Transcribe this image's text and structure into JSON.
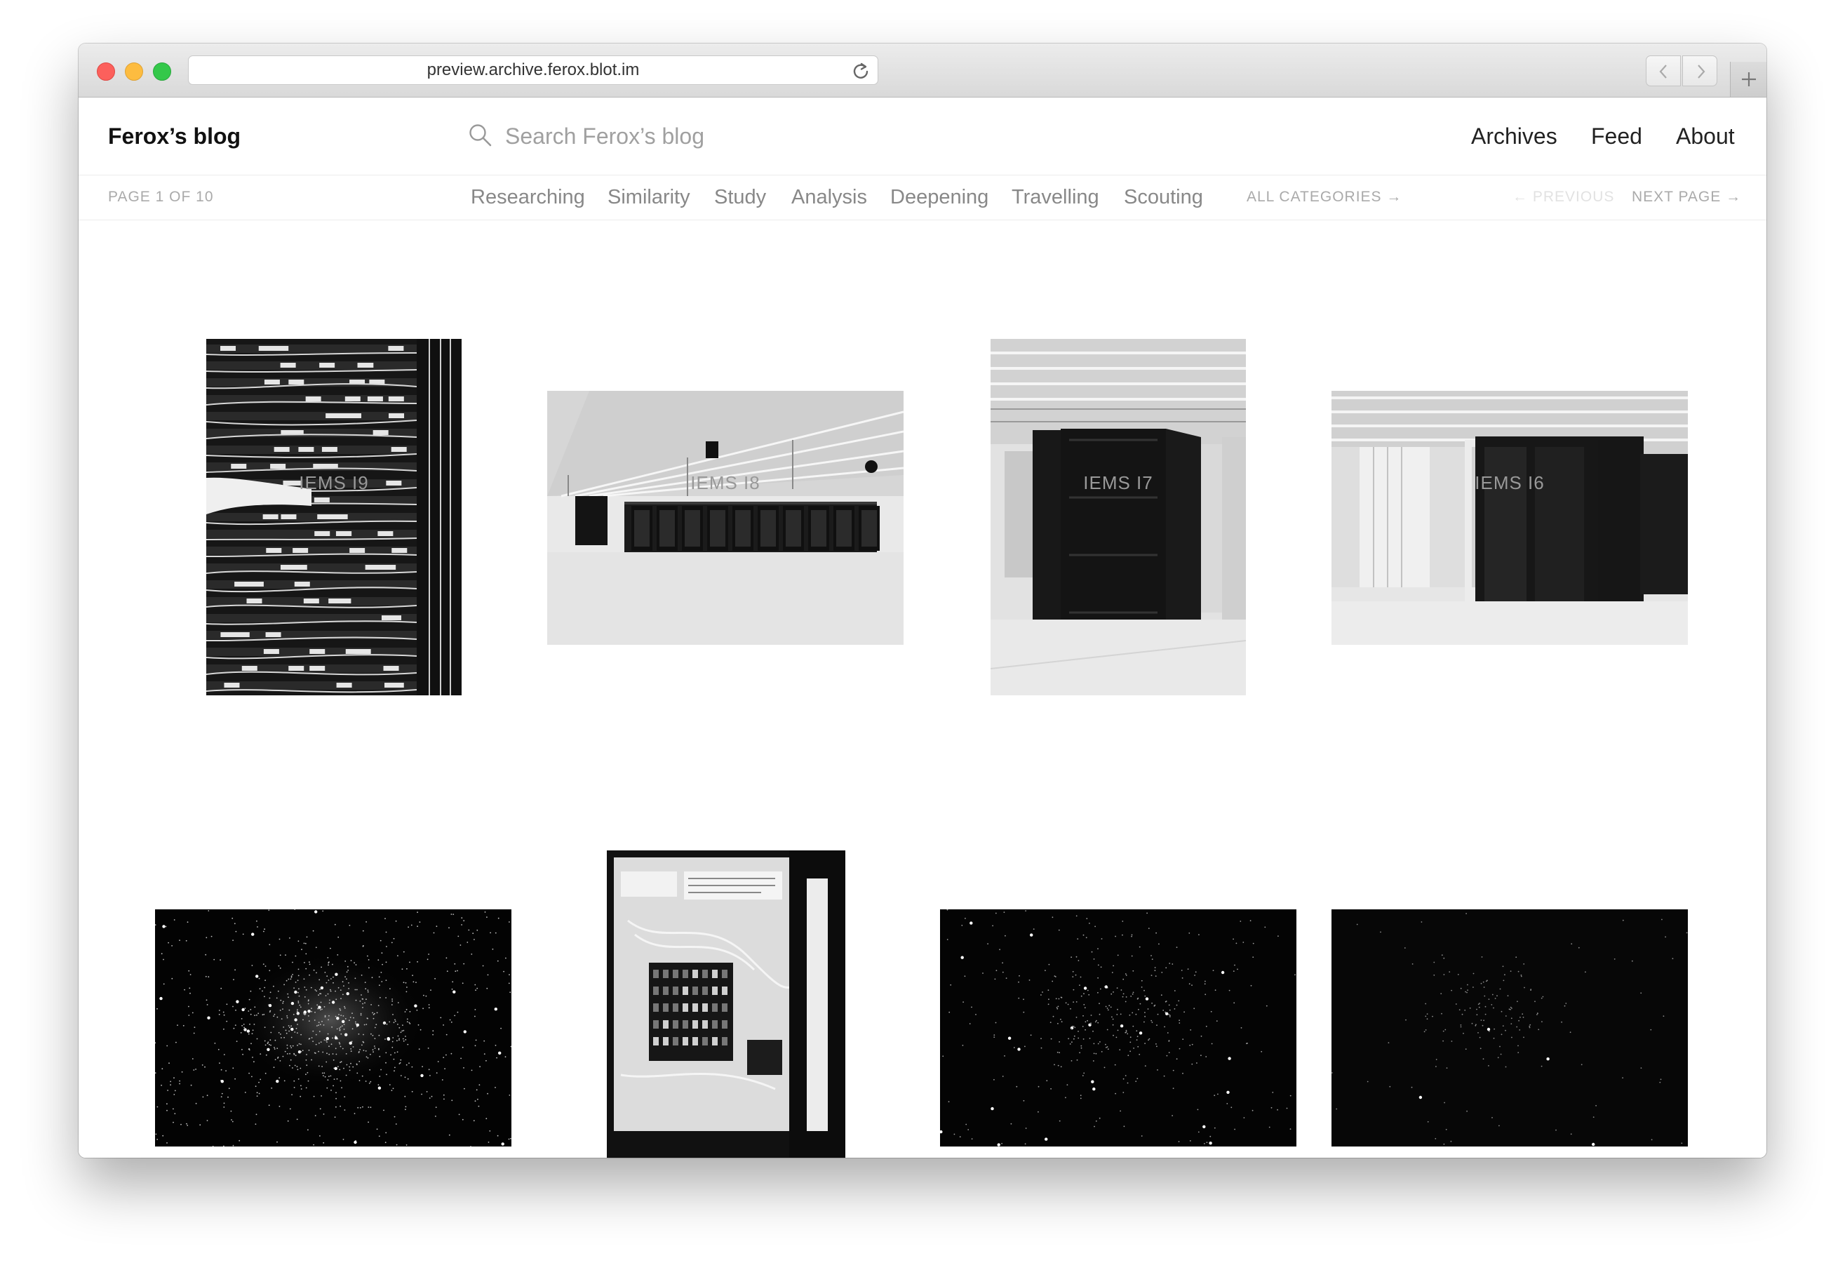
{
  "browser": {
    "url": "preview.archive.ferox.blot.im"
  },
  "header": {
    "blog_title": "Ferox’s blog",
    "search_placeholder": "Search Ferox’s blog",
    "nav": [
      "Archives",
      "Feed",
      "About"
    ]
  },
  "subnav": {
    "page_info": "PAGE 1 OF 10",
    "categories": [
      "Researching",
      "Similarity",
      "Study",
      "Analysis",
      "Deepening",
      "Travelling",
      "Scouting"
    ],
    "all_categories": "ALL CATEGORIES →",
    "previous": "← PREVIOUS",
    "next": "NEXT PAGE →"
  },
  "posts": [
    {
      "title": "IEMS I9",
      "image": "cable-rack-photo"
    },
    {
      "title": "IEMS I8",
      "image": "server-hall-photo"
    },
    {
      "title": "IEMS I7",
      "image": "server-cabinet-photo"
    },
    {
      "title": "IEMS I6",
      "image": "server-cabinets-photo"
    },
    {
      "title": "",
      "image": "star-cluster-photo"
    },
    {
      "title": "",
      "image": "electrical-panel-photo"
    },
    {
      "title": "",
      "image": "star-field-photo"
    },
    {
      "title": "",
      "image": "dark-star-field-photo"
    }
  ]
}
